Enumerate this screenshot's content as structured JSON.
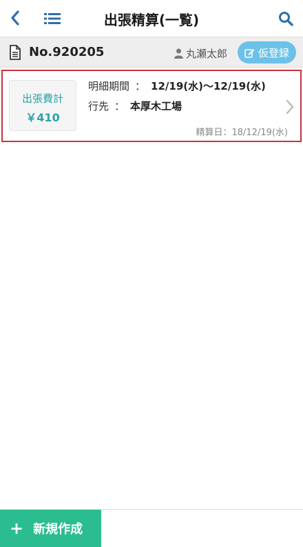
{
  "header": {
    "title": "出張精算(一覧)"
  },
  "subbar": {
    "doc_number": "No.920205",
    "user_name": "丸瀬太郎",
    "register_label": "仮登録"
  },
  "card": {
    "amount_label": "出張費計",
    "amount_value": "￥410",
    "period_label": "明細期間",
    "period_sep": "：",
    "period_value": "12/19(水)〜12/19(水)",
    "dest_label": "行先",
    "dest_sep": "：",
    "dest_value": "本厚木工場",
    "settle_date": "精算日：18/12/19(水)"
  },
  "footer": {
    "new_label": "新規作成",
    "plus": "+"
  },
  "colors": {
    "accent_teal": "#2aa3a6",
    "new_button": "#2bbd8f",
    "register_button": "#6cc1e8",
    "highlight_border": "#c9323a",
    "icon_blue": "#2f6fa8"
  }
}
